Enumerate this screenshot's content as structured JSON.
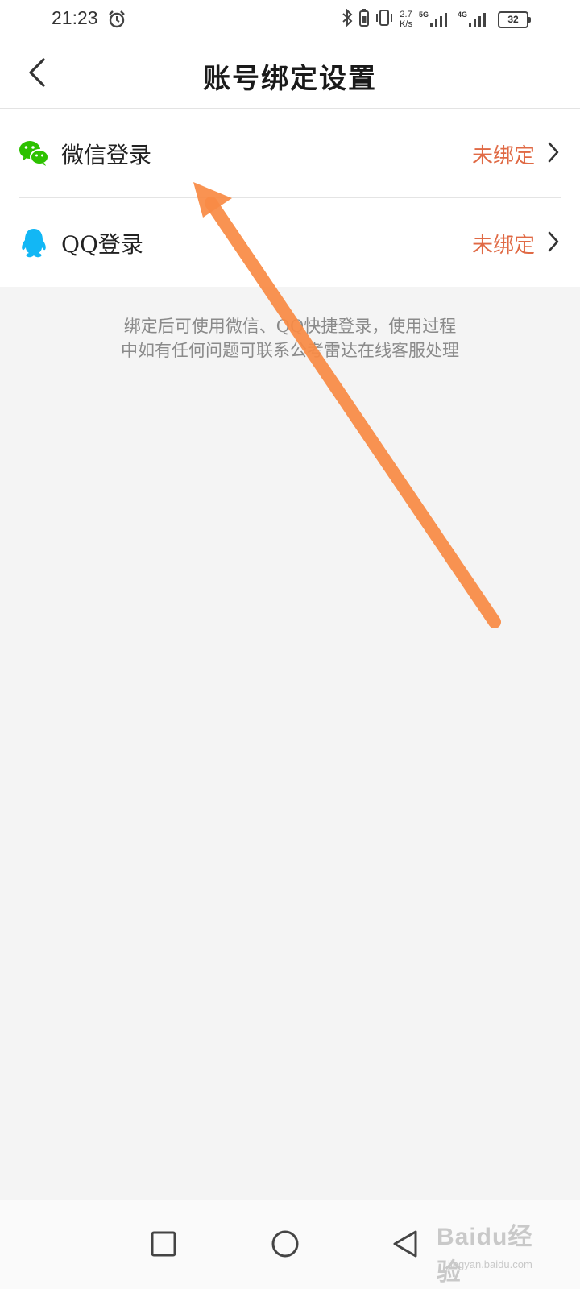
{
  "status_bar": {
    "time": "21:23",
    "speed_value": "2.7",
    "speed_unit": "K/s",
    "net1": "5G",
    "net2": "4G",
    "battery": "32",
    "icons": [
      "alarm-icon",
      "bluetooth-icon",
      "battery-saver-icon",
      "vibrate-icon",
      "signal-icon",
      "signal-icon"
    ]
  },
  "header": {
    "title": "账号绑定设置",
    "back_icon": "chevron-left-icon"
  },
  "bindings": [
    {
      "label": "微信登录",
      "status": "未绑定",
      "icon": "wechat-icon",
      "brand_color": "#2dc100"
    },
    {
      "label": "QQ登录",
      "status": "未绑定",
      "icon": "qq-icon",
      "brand_color": "#12b7f5"
    }
  ],
  "note": {
    "line1": "绑定后可使用微信、QQ快捷登录，使用过程",
    "line2": "中如有任何问题可联系公考雷达在线客服处理"
  },
  "colors": {
    "status_unbound": "#e06a45",
    "background": "#f4f4f4",
    "annotation_arrow": "#f98b45"
  },
  "navbar": {
    "icons": [
      "recent-apps-icon",
      "home-icon",
      "back-triangle-icon"
    ]
  },
  "watermark": {
    "logo": "Baidu经验",
    "url": "jingyan.baidu.com"
  }
}
